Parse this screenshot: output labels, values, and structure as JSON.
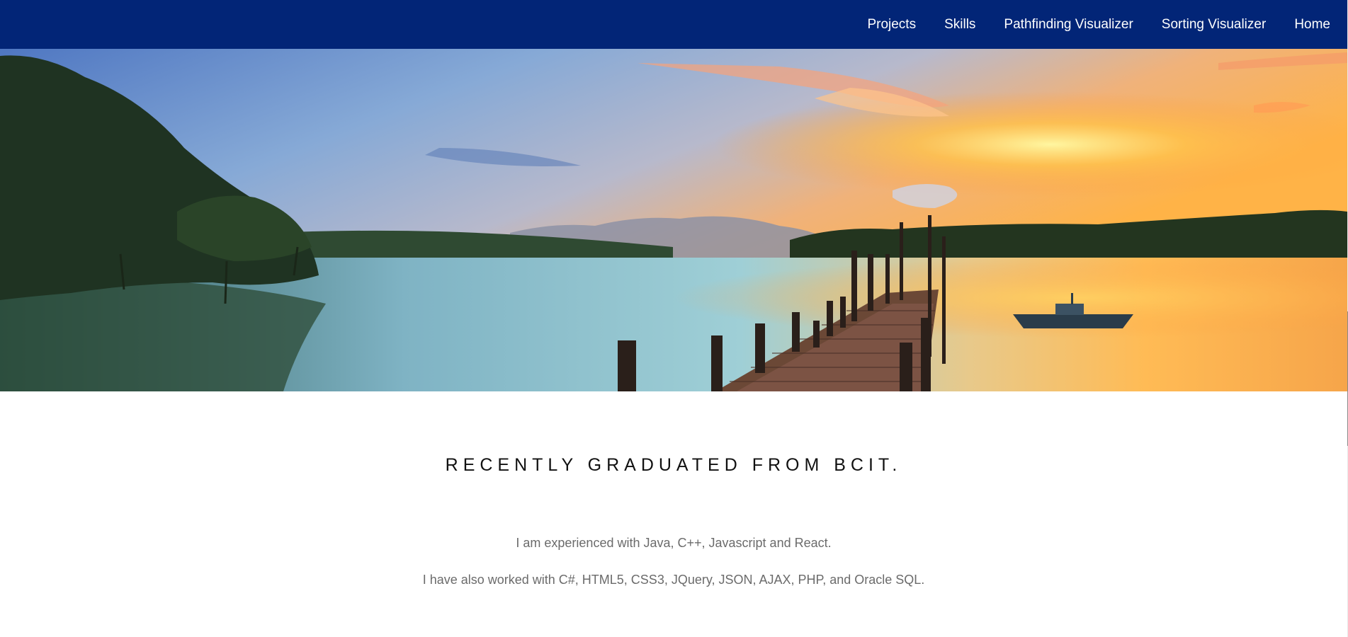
{
  "nav": {
    "items": [
      {
        "label": "Projects"
      },
      {
        "label": "Skills"
      },
      {
        "label": "Pathfinding Visualizer"
      },
      {
        "label": "Sorting Visualizer"
      },
      {
        "label": "Home"
      }
    ]
  },
  "hero": {
    "image": "lake-pier-sunset"
  },
  "intro": {
    "tagline": "RECENTLY GRADUATED FROM BCIT.",
    "paragraph_1": "I am experienced with Java, C++, Javascript and React.",
    "paragraph_2": "I have also worked with C#, HTML5, CSS3, JQuery, JSON, AJAX, PHP, and Oracle SQL."
  },
  "colors": {
    "navbar": "#022577",
    "nav_text": "#ffffff",
    "tagline": "#111111",
    "paragraph": "#6b6b6b"
  }
}
